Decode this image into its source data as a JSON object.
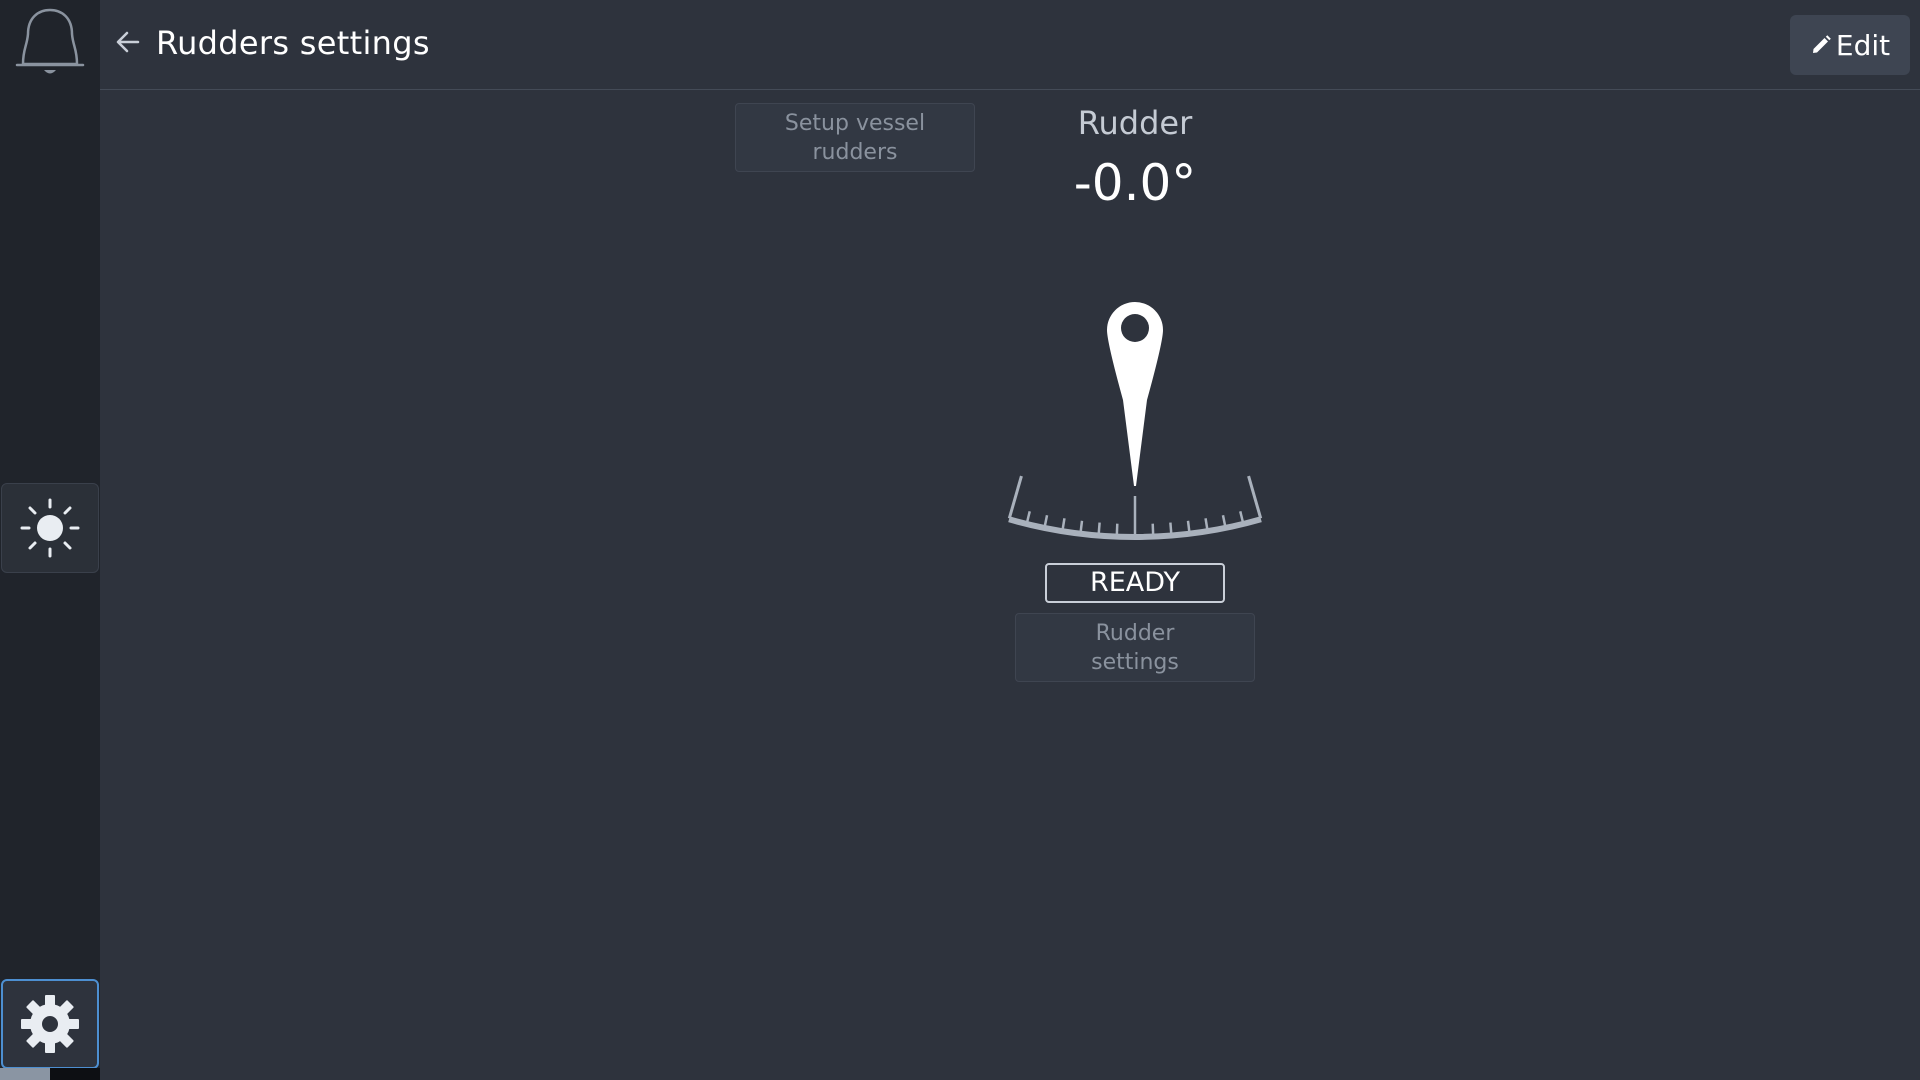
{
  "sidebar": {
    "icons": [
      "bell-icon",
      "sun-icon",
      "gear-icon"
    ]
  },
  "header": {
    "title": "Rudders settings",
    "back_icon": "arrow-left-icon",
    "edit_label": "Edit",
    "edit_icon": "pencil-icon"
  },
  "main": {
    "setup_button": "Setup vessel\nrudders",
    "rudder": {
      "label": "Rudder",
      "angle": "-0.0°",
      "angle_value": 0.0,
      "status": "READY",
      "settings_button": "Rudder\nsettings"
    }
  },
  "colors": {
    "background": "#2e333d",
    "sidebar": "#20242b",
    "active_border": "#4d8fd1",
    "scale": "#a9b1bc"
  }
}
